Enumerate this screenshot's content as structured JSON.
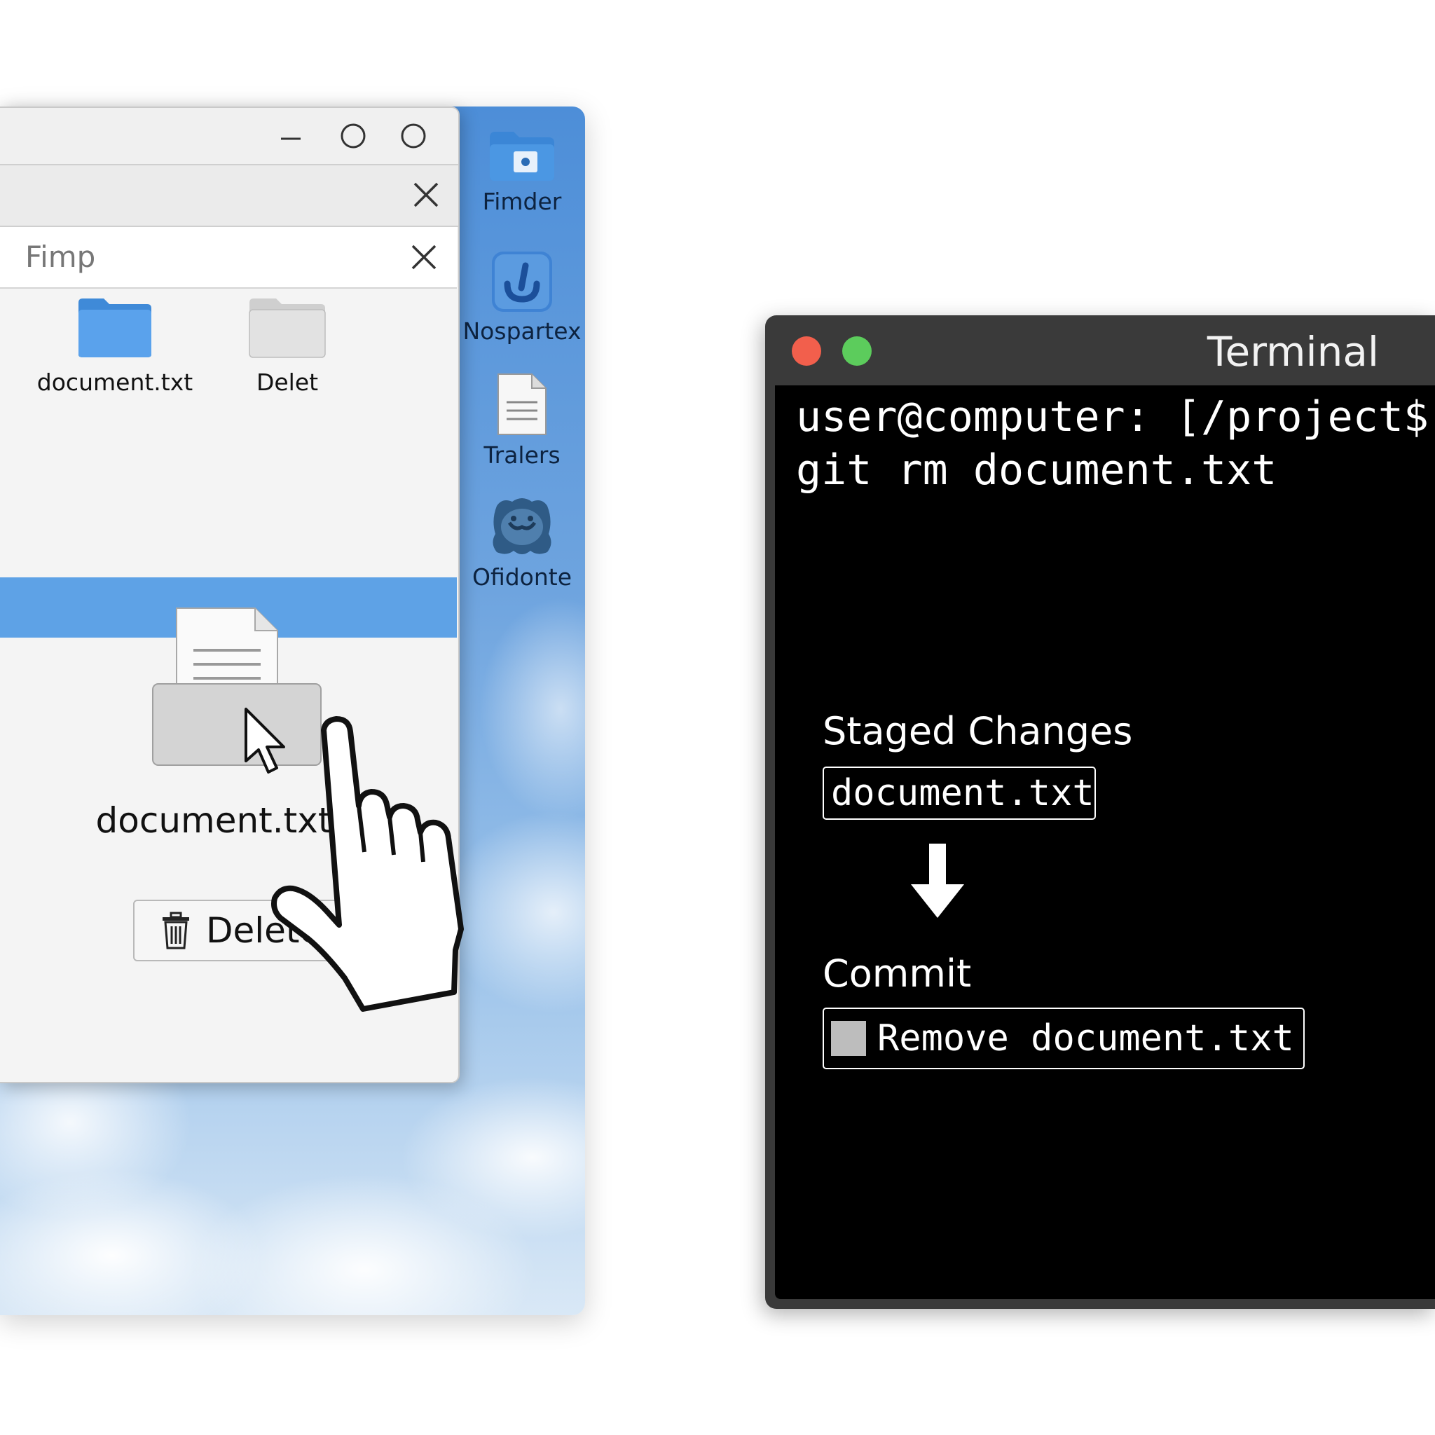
{
  "desktop": {
    "icons": [
      {
        "label": "Fimder",
        "icon": "finder-folder-icon"
      },
      {
        "label": "Nospartex",
        "icon": "blue-app-icon"
      },
      {
        "label": "Tralers",
        "icon": "document-icon"
      },
      {
        "label": "Ofidonte",
        "icon": "mascot-app-icon"
      }
    ]
  },
  "file_manager": {
    "window_controls": [
      "minimize",
      "maximize",
      "restore"
    ],
    "panel_title": "Fimp",
    "grid_items": [
      {
        "label": "document.txt",
        "icon": "blue-folder-icon"
      },
      {
        "label": "Delet",
        "icon": "gray-folder-icon"
      }
    ],
    "selected_file_label": "document.txt",
    "delete_button_label": "Delete"
  },
  "terminal": {
    "title": "Terminal",
    "prompt_line": "user@computer: [/project$",
    "command_line": "git rm document.txt",
    "staged_label": "Staged Changes",
    "staged_file": "document.txt",
    "commit_label": "Commit",
    "commit_message": "Remove document.txt"
  },
  "colors": {
    "selection_blue": "#5ea2e6",
    "terminal_bg": "#000000",
    "traffic_red": "#f25f4c",
    "traffic_green": "#5ccc5c"
  }
}
